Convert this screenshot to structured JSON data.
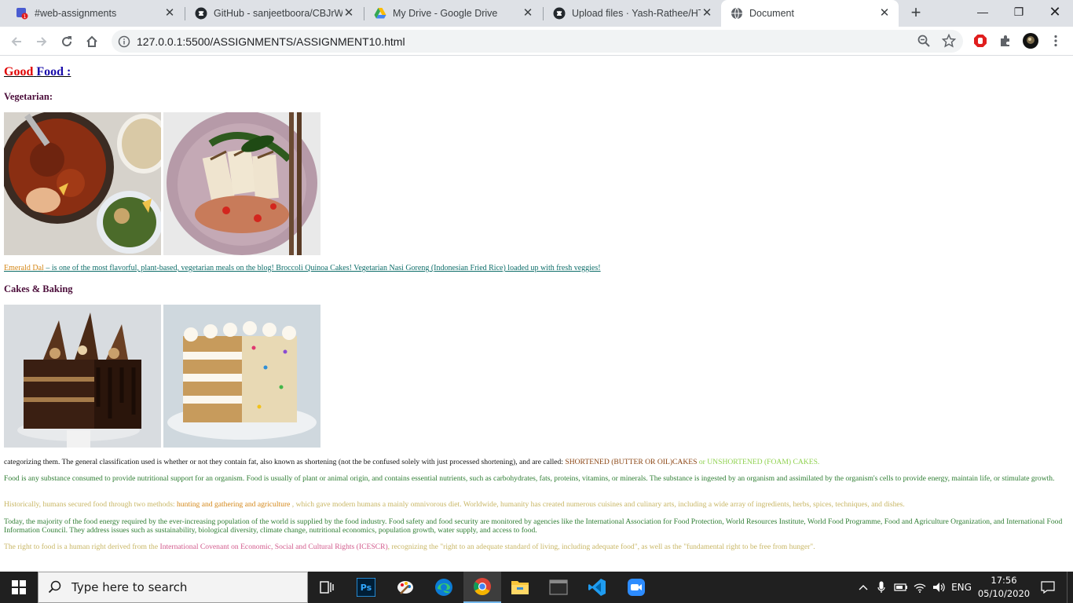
{
  "browser": {
    "tabs": [
      {
        "title": "#web-assignments",
        "icon": "slack-notification-icon"
      },
      {
        "title": "GitHub - sanjeetboora/CBJrWe",
        "icon": "github-icon"
      },
      {
        "title": "My Drive - Google Drive",
        "icon": "google-drive-icon"
      },
      {
        "title": "Upload files · Yash-Rathee/HTM",
        "icon": "github-icon"
      },
      {
        "title": "Document",
        "icon": "globe-icon",
        "active": true
      }
    ],
    "url": "127.0.0.1:5500/ASSIGNMENTS/ASSIGNMENT10.html",
    "accent": "#dee1e6"
  },
  "page": {
    "heading_word1": "Good",
    "heading_word2": "Food :",
    "section1_title": "Vegetarian:",
    "section1_images": [
      {
        "alt": "chili stew with rice"
      },
      {
        "alt": "grilled tofu bowl"
      }
    ],
    "caption_part1": "Emerald Dal",
    "caption_part2": " – is one of the most flavorful, plant-based, vegetarian meals on the blog! Broccoli Quinoa Cakes! Vegetarian Nasi Goreng (Indonesian Fried Rice) loaded up with fresh veggies!",
    "section2_title": "Cakes & Baking",
    "section2_images": [
      {
        "alt": "chocolate layer cake"
      },
      {
        "alt": "funfetti layer cake"
      }
    ],
    "p1_main": "categorizing them. The general classification used is whether or not they contain fat, also known as shortening (not the be confused solely with just processed shortening), and are called: ",
    "p1_span1": "SHORTENED (BUTTER OR OIL)CAKES",
    "p1_span2": " or UNSHORTENED (FOAM) CAKES.",
    "p2": "Food is any substance consumed to provide nutritional support for an organism. Food is usually of plant or animal origin, and contains essential nutrients, such as carbohydrates, fats, proteins, vitamins, or minerals. The substance is ingested by an organism and assimilated by the organism's cells to provide energy, maintain life, or stimulate growth.",
    "p3_pre": "Historically, humans secured food through two methods: ",
    "p3_span": "hunting and gathering and agriculture",
    "p3_post": " , which gave modern humans a mainly omnivorous diet. Worldwide, humanity has created numerous cuisines and culinary arts, including a wide array of ingredients, herbs, spices, techniques, and dishes.",
    "p4": "Today, the majority of the food energy required by the ever-increasing population of the world is supplied by the food industry. Food safety and food security are monitored by agencies like the International Association for Food Protection, World Resources Institute, World Food Programme, Food and Agriculture Organization, and International Food Information Council. They address issues such as sustainability, biological diversity, climate change, nutritional economics, population growth, water supply, and access to food.",
    "p5_pre": "The right to food is a human right derived from the ",
    "p5_span": "International Covenant on Economic, Social and Cultural Rights (ICESCR)",
    "p5_post": ", recognizing the \"right to an adequate standard of living, including adequate food\", as well as the \"fundamental right to be free from hunger\"."
  },
  "taskbar": {
    "search_placeholder": "Type here to search",
    "apps": [
      "task-view-icon",
      "photoshop-icon",
      "paint-icon",
      "edge-icon",
      "chrome-icon",
      "file-explorer-icon",
      "terminal-icon",
      "vscode-icon",
      "zoom-icon"
    ],
    "language": "ENG",
    "time": "17:56",
    "date": "05/10/2020"
  }
}
